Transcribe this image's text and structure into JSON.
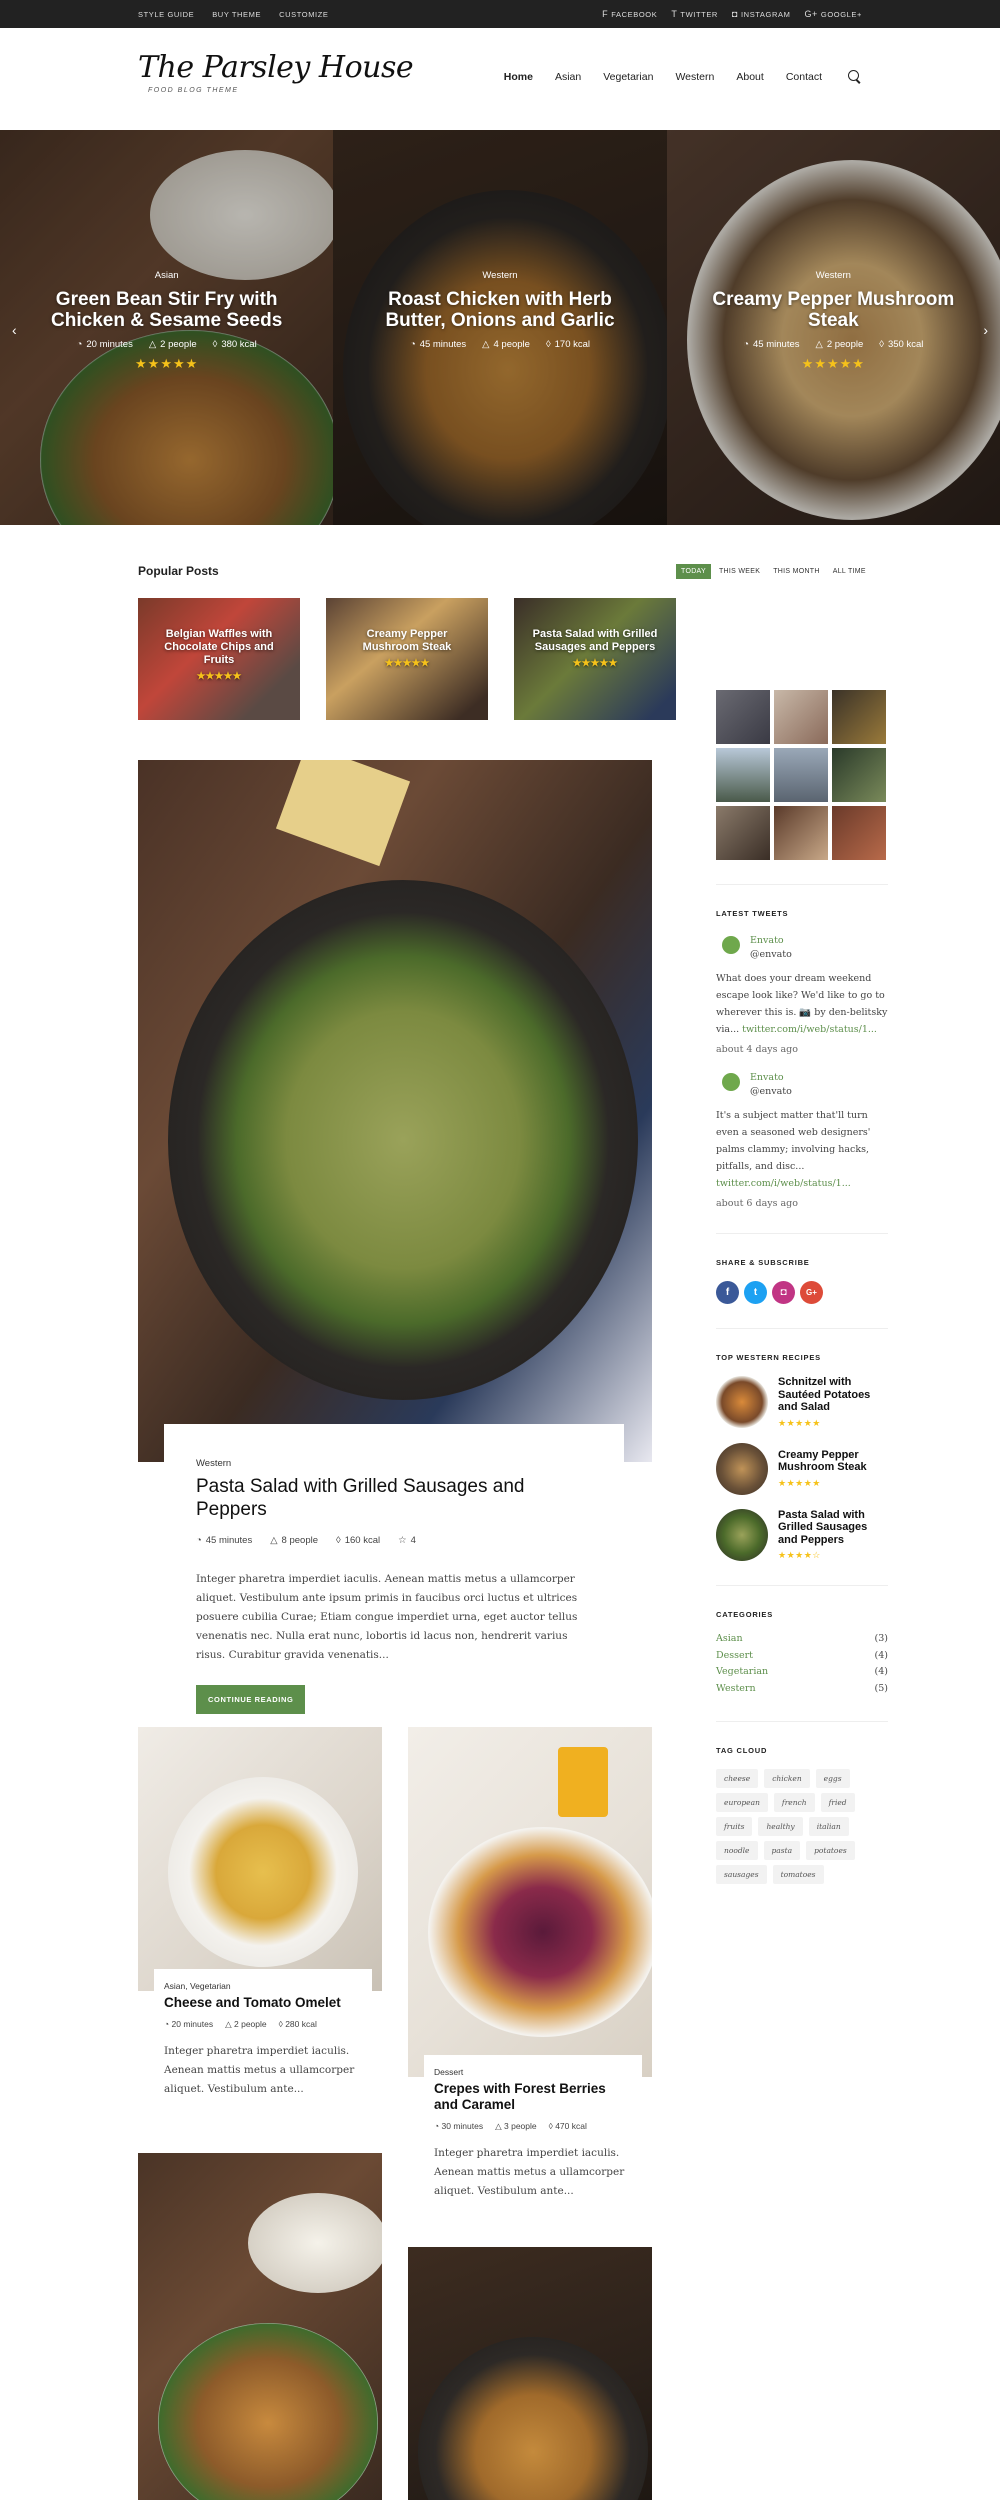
{
  "topbar": {
    "left": [
      "Style Guide",
      "Buy Theme",
      "Customize"
    ],
    "right": [
      {
        "label": "Facebook",
        "icon": "f"
      },
      {
        "label": "Twitter",
        "icon": "t"
      },
      {
        "label": "Instagram",
        "icon": "◘"
      },
      {
        "label": "Google+",
        "icon": "G+"
      }
    ]
  },
  "logo": {
    "title": "The Parsley House",
    "tagline": "FOOD BLOG THEME"
  },
  "nav": [
    "Home",
    "Asian",
    "Vegetarian",
    "Western",
    "About",
    "Contact"
  ],
  "slider": [
    {
      "category": "Asian",
      "title": "Green Bean Stir Fry with Chicken & Sesame Seeds",
      "time": "20 minutes",
      "people": "2 people",
      "kcal": "380 kcal",
      "stars": "★★★★★"
    },
    {
      "category": "Western",
      "title": "Roast Chicken with Herb Butter, Onions and Garlic",
      "time": "45 minutes",
      "people": "4 people",
      "kcal": "170 kcal",
      "stars": ""
    },
    {
      "category": "Western",
      "title": "Creamy Pepper Mushroom Steak",
      "time": "45 minutes",
      "people": "2 people",
      "kcal": "350 kcal",
      "stars": "★★★★★"
    }
  ],
  "popular": {
    "title": "Popular Posts",
    "tabs": [
      "Today",
      "This Week",
      "This Month",
      "All Time"
    ],
    "cards": [
      {
        "title": "Belgian Waffles with Chocolate Chips and Fruits",
        "stars": "★★★★★"
      },
      {
        "title": "Creamy Pepper Mushroom Steak",
        "stars": "★★★★★"
      },
      {
        "title": "Pasta Salad with Grilled Sausages and Peppers",
        "stars": "★★★★★"
      }
    ]
  },
  "featured": {
    "category": "Western",
    "title": "Pasta Salad with Grilled Sausages and Peppers",
    "time": "45 minutes",
    "people": "8 people",
    "kcal": "160 kcal",
    "rating": "4",
    "excerpt": "Integer pharetra imperdiet iaculis. Aenean mattis metus a ullamcorper aliquet. Vestibulum ante ipsum primis in faucibus orci luctus et ultrices posuere cubilia Curae; Etiam congue imperdiet urna, eget auctor tellus venenatis nec. Nulla erat nunc, lobortis id lacus non, hendrerit varius risus. Curabitur gravida venenatis...",
    "button": "Continue Reading"
  },
  "grid": [
    {
      "category": "Asian, Vegetarian",
      "title": "Cheese and Tomato Omelet",
      "time": "20 minutes",
      "people": "2 people",
      "kcal": "280 kcal",
      "excerpt": "Integer pharetra imperdiet iaculis. Aenean mattis metus a ullamcorper aliquet. Vestibulum ante..."
    },
    {
      "category": "Dessert",
      "title": "Crepes with Forest Berries and Caramel",
      "time": "30 minutes",
      "people": "3 people",
      "kcal": "470 kcal",
      "excerpt": "Integer pharetra imperdiet iaculis. Aenean mattis metus a ullamcorper aliquet. Vestibulum ante..."
    }
  ],
  "sidebar": {
    "tweets_title": "Latest Tweets",
    "tweets": [
      {
        "name": "Envato",
        "handle": "@envato",
        "text": "What does your dream weekend escape look like? We'd like to go to wherever this is. 📷 by den-belitsky via...",
        "link": "twitter.com/i/web/status/1...",
        "time": "about 4 days ago"
      },
      {
        "name": "Envato",
        "handle": "@envato",
        "text": "It's a subject matter that'll turn even a seasoned web designers' palms clammy; involving hacks, pitfalls, and disc...",
        "link": "twitter.com/i/web/status/1...",
        "time": "about 6 days ago"
      }
    ],
    "share_title": "Share & Subscribe",
    "social": [
      {
        "icon": "f",
        "color": "#3b5998"
      },
      {
        "icon": "t",
        "color": "#1da1f2"
      },
      {
        "icon": "◘",
        "color": "#c13584"
      },
      {
        "icon": "G+",
        "color": "#dd4b39"
      }
    ],
    "recipes_title": "Top Western Recipes",
    "recipes": [
      {
        "name": "Schnitzel with Sautéed Potatoes and Salad",
        "stars": "★★★★★"
      },
      {
        "name": "Creamy Pepper Mushroom Steak",
        "stars": "★★★★★"
      },
      {
        "name": "Pasta Salad with Grilled Sausages and Peppers",
        "stars": "★★★★☆"
      }
    ],
    "categories_title": "Categories",
    "categories": [
      {
        "name": "Asian",
        "count": "(3)"
      },
      {
        "name": "Dessert",
        "count": "(4)"
      },
      {
        "name": "Vegetarian",
        "count": "(4)"
      },
      {
        "name": "Western",
        "count": "(5)"
      }
    ],
    "tags_title": "Tag Cloud",
    "tags": [
      "cheese",
      "chicken",
      "eggs",
      "european",
      "french",
      "fried",
      "fruits",
      "healthy",
      "italian",
      "noodle",
      "pasta",
      "potatoes",
      "sausages",
      "tomatoes"
    ]
  },
  "colors": {
    "accent": "#5d8f4b",
    "star": "#f6c21a",
    "topbar": "#222222"
  }
}
